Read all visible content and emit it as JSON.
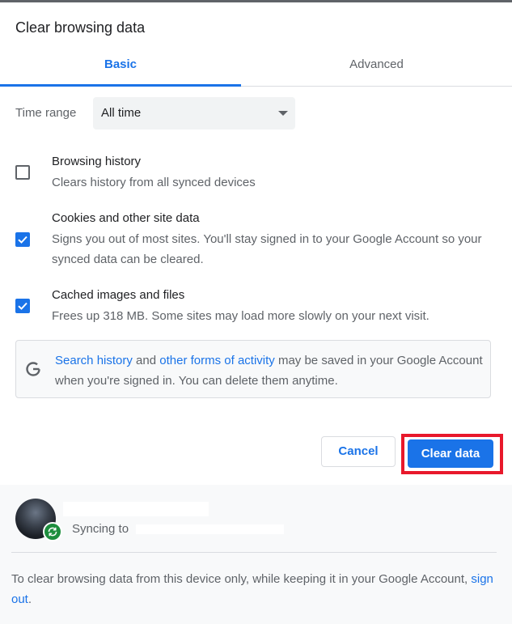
{
  "dialog": {
    "title": "Clear browsing data"
  },
  "tabs": {
    "basic": "Basic",
    "advanced": "Advanced"
  },
  "time_range": {
    "label": "Time range",
    "value": "All time"
  },
  "options": {
    "history": {
      "title": "Browsing history",
      "desc": "Clears history from all synced devices",
      "checked": false
    },
    "cookies": {
      "title": "Cookies and other site data",
      "desc": "Signs you out of most sites. You'll stay signed in to your Google Account so your synced data can be cleared.",
      "checked": true
    },
    "cache": {
      "title": "Cached images and files",
      "desc": "Frees up 318 MB. Some sites may load more slowly on your next visit.",
      "checked": true
    }
  },
  "google_notice": {
    "link1": "Search history",
    "text1": " and ",
    "link2": "other forms of activity",
    "text2": " may be saved in your Google Account when you're signed in. You can delete them anytime."
  },
  "buttons": {
    "cancel": "Cancel",
    "clear": "Clear data"
  },
  "account": {
    "sync_label": "Syncing to"
  },
  "footer": {
    "text": "To clear browsing data from this device only, while keeping it in your Google Account, ",
    "link": "sign out",
    "end": "."
  },
  "colors": {
    "accent": "#1a73e8",
    "highlight": "#e8182b",
    "sync_green": "#1e8e3e"
  }
}
